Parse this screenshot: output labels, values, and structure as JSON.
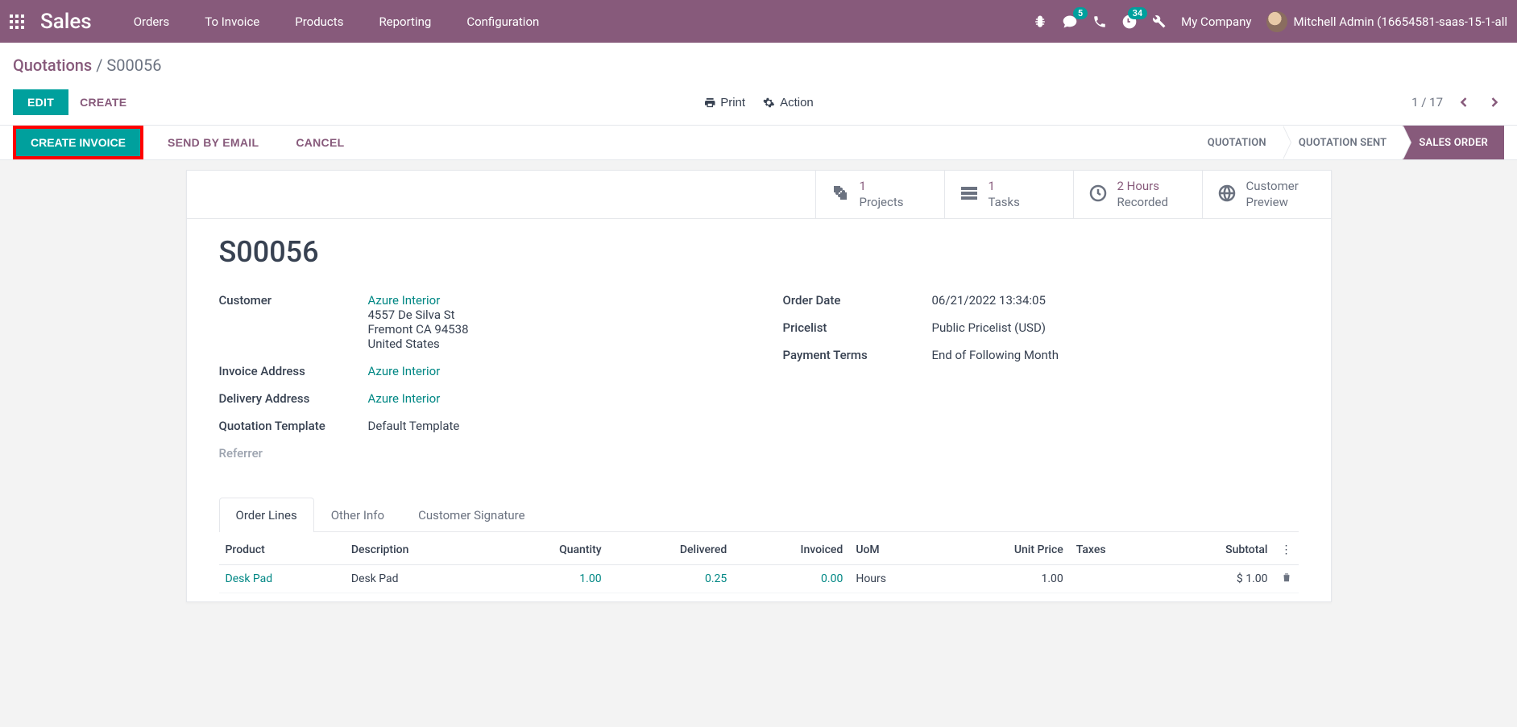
{
  "header": {
    "app_title": "Sales",
    "menu": [
      "Orders",
      "To Invoice",
      "Products",
      "Reporting",
      "Configuration"
    ],
    "msg_badge": "5",
    "activity_badge": "34",
    "company": "My Company",
    "user": "Mitchell Admin (16654581-saas-15-1-all"
  },
  "breadcrumb": {
    "parent": "Quotations",
    "current": "S00056"
  },
  "control": {
    "edit": "EDIT",
    "create": "CREATE",
    "print": "Print",
    "action": "Action",
    "pager": "1 / 17"
  },
  "statusbar": {
    "create_invoice": "CREATE INVOICE",
    "send_email": "SEND BY EMAIL",
    "cancel": "CANCEL",
    "steps": [
      "QUOTATION",
      "QUOTATION SENT",
      "SALES ORDER"
    ]
  },
  "stats": {
    "projects_val": "1",
    "projects_lbl": "Projects",
    "tasks_val": "1",
    "tasks_lbl": "Tasks",
    "hours_val": "2 Hours",
    "hours_lbl": "Recorded",
    "preview_val": "Customer",
    "preview_lbl": "Preview"
  },
  "record": {
    "title": "S00056",
    "customer_lbl": "Customer",
    "customer_name": "Azure Interior",
    "customer_addr1": "4557 De Silva St",
    "customer_addr2": "Fremont CA 94538",
    "customer_addr3": "United States",
    "invoice_addr_lbl": "Invoice Address",
    "invoice_addr": "Azure Interior",
    "delivery_addr_lbl": "Delivery Address",
    "delivery_addr": "Azure Interior",
    "template_lbl": "Quotation Template",
    "template": "Default Template",
    "referrer_lbl": "Referrer",
    "order_date_lbl": "Order Date",
    "order_date": "06/21/2022 13:34:05",
    "pricelist_lbl": "Pricelist",
    "pricelist": "Public Pricelist (USD)",
    "terms_lbl": "Payment Terms",
    "terms": "End of Following Month"
  },
  "tabs": {
    "order_lines": "Order Lines",
    "other_info": "Other Info",
    "signature": "Customer Signature"
  },
  "table": {
    "h_product": "Product",
    "h_desc": "Description",
    "h_qty": "Quantity",
    "h_delivered": "Delivered",
    "h_invoiced": "Invoiced",
    "h_uom": "UoM",
    "h_price": "Unit Price",
    "h_taxes": "Taxes",
    "h_subtotal": "Subtotal",
    "rows": [
      {
        "product": "Desk Pad",
        "desc": "Desk Pad",
        "qty": "1.00",
        "delivered": "0.25",
        "invoiced": "0.00",
        "uom": "Hours",
        "price": "1.00",
        "taxes": "",
        "subtotal": "$ 1.00"
      }
    ]
  }
}
